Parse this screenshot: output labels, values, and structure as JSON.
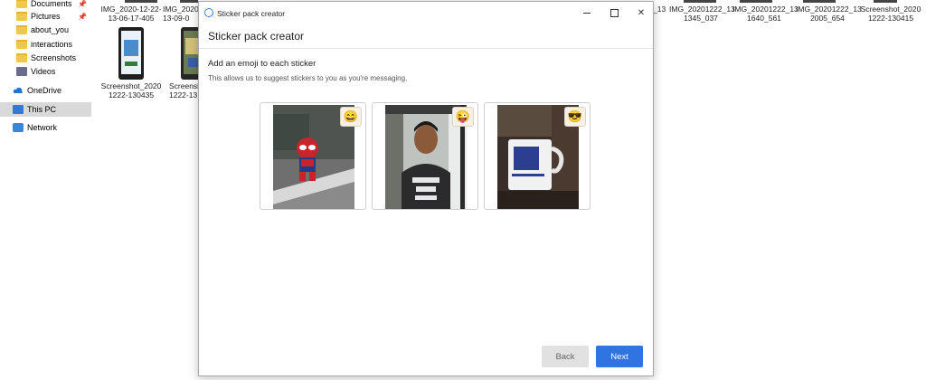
{
  "explorer": {
    "nav_items": [
      {
        "label": "Documents",
        "icon": "folder-icon",
        "pinned": true
      },
      {
        "label": "Pictures",
        "icon": "folder-icon",
        "pinned": true
      },
      {
        "label": "about_you",
        "icon": "folder-icon",
        "pinned": false
      },
      {
        "label": "interactions",
        "icon": "folder-icon",
        "pinned": false
      },
      {
        "label": "Screenshots",
        "icon": "folder-icon",
        "pinned": false
      },
      {
        "label": "Videos",
        "icon": "video-folder-icon",
        "pinned": false
      },
      {
        "label": "OneDrive",
        "icon": "cloud-icon",
        "pinned": false
      },
      {
        "label": "This PC",
        "icon": "pc-icon",
        "pinned": false,
        "selected": true
      },
      {
        "label": "Network",
        "icon": "network-icon",
        "pinned": false
      }
    ],
    "pin_glyph": "📌",
    "files_top": [
      {
        "line1": "IMG_2020-12-22-",
        "line2": "13-06-17-405"
      },
      {
        "line1": "IMG_2020",
        "line2": "13-09-0"
      },
      {
        "line1": "_13",
        "line2": ""
      },
      {
        "line1": "IMG_20201222_13",
        "line2": "1345_037"
      },
      {
        "line1": "IMG_20201222_13",
        "line2": "1640_561"
      },
      {
        "line1": "IMG_20201222_13",
        "line2": "2005_654"
      },
      {
        "line1": "Screenshot_2020",
        "line2": "1222-130415"
      }
    ],
    "files_row2": [
      {
        "line1": "Screenshot_2020",
        "line2": "1222-130435"
      },
      {
        "line1": "Screensh",
        "line2": "1222-13"
      }
    ]
  },
  "dialog": {
    "window_title": "Sticker pack creator",
    "header_title": "Sticker pack creator",
    "instruction": "Add an emoji to each sticker",
    "subtext": "This allows us to suggest stickers to you as you're messaging.",
    "close_glyph": "✕",
    "stickers": [
      {
        "subject": "spiderman-figure-photo",
        "emoji": "😄"
      },
      {
        "subject": "man-portrait-photo",
        "emoji": "😜"
      },
      {
        "subject": "mug-photo",
        "emoji": "😎"
      }
    ],
    "back_label": "Back",
    "next_label": "Next"
  }
}
